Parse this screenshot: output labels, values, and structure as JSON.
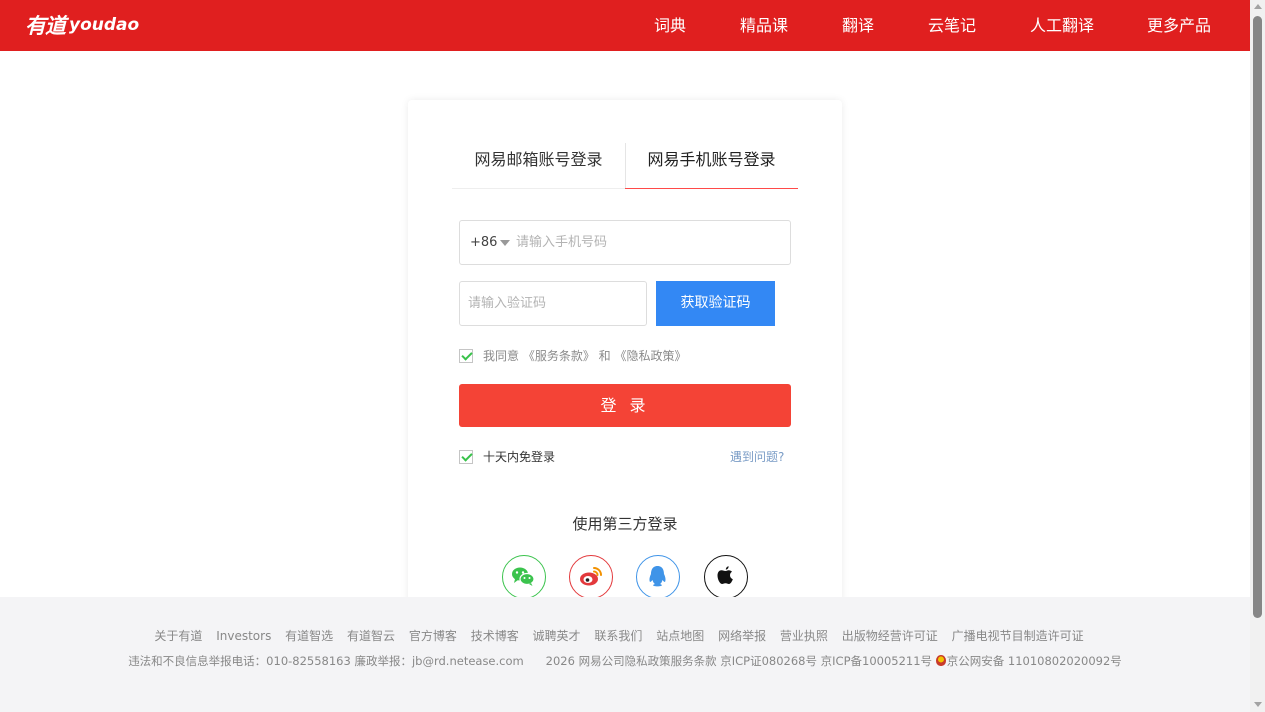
{
  "header": {
    "logo_cn": "有道",
    "logo_en": "youdao",
    "nav": [
      "词典",
      "精品课",
      "翻译",
      "云笔记",
      "人工翻译",
      "更多产品"
    ],
    "background_color": "#e01f1f"
  },
  "login": {
    "tabs": {
      "email": "网易邮箱账号登录",
      "phone": "网易手机账号登录",
      "active": "phone"
    },
    "country_code": "+86",
    "phone_placeholder": "请输入手机号码",
    "code_placeholder": "请输入验证码",
    "get_code_label": "获取验证码",
    "agree": {
      "prefix": "我同意 ",
      "terms": "《服务条款》",
      "and": " 和 ",
      "privacy": "《隐私政策》",
      "checked": true
    },
    "login_label": "登 录",
    "remember_label": "十天内免登录",
    "remember_checked": true,
    "help_label": "遇到问题?",
    "third_party_title": "使用第三方登录",
    "third_party": [
      "wechat-icon",
      "weibo-icon",
      "qq-icon",
      "apple-icon"
    ]
  },
  "footer": {
    "links": [
      "关于有道",
      "Investors",
      "有道智选",
      "有道智云",
      "官方博客",
      "技术博客",
      "诚聘英才",
      "联系我们",
      "站点地图",
      "网络举报",
      "营业执照",
      "出版物经营许可证",
      "广播电视节目制造许可证"
    ],
    "report_line": "违法和不良信息举报电话：010-82558163 廉政举报：jb@rd.netease.com",
    "copyright_line": "2026 网易公司隐私政策服务条款 京ICP证080268号 京ICP备10005211号",
    "police_line": "京公网安备 11010802020092号"
  },
  "colors": {
    "login_button": "#f44336",
    "get_code_button": "#3388f4",
    "active_tab_underline": "#ff4a49"
  }
}
